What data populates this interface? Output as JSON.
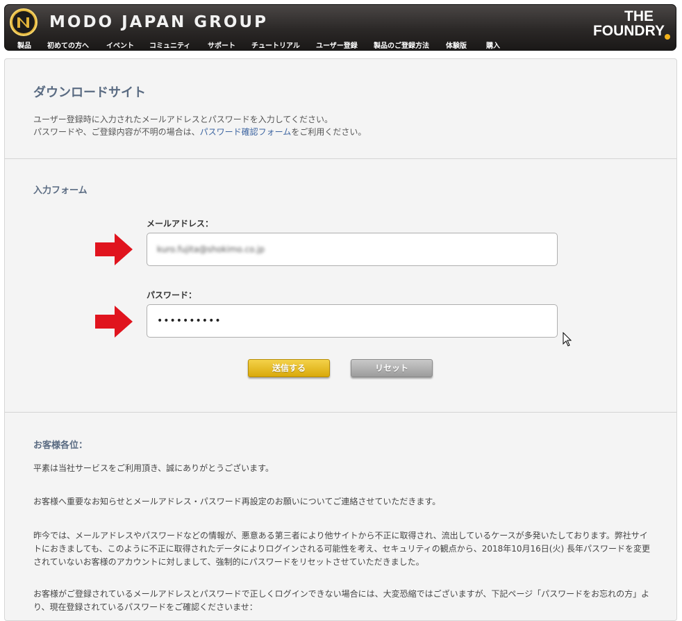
{
  "header": {
    "brand_title": "MODO JAPAN GROUP",
    "foundry_line1": "THE",
    "foundry_line2": "FOUNDRY",
    "nav": [
      "製品",
      "初めての方へ",
      "イベント",
      "コミュニティ",
      "サポート",
      "チュートリアル",
      "ユーザー登録",
      "製品のご登録方法",
      "体験版",
      "購入"
    ]
  },
  "main": {
    "title": "ダウンロードサイト",
    "intro_line1": "ユーザー登録時に入力されたメールアドレスとパスワードを入力してください。",
    "intro_line2_before": "パスワードや、ご登録内容が不明の場合は、",
    "intro_line2_link": "パスワード確認フォーム",
    "intro_line2_after": "をご利用ください。"
  },
  "form": {
    "title": "入力フォーム",
    "email_label": "メールアドレス：",
    "email_value": "kuro.fujita@shokimo.co.jp",
    "password_label": "パスワード：",
    "password_value": "••••••••••",
    "submit_label": "送信する",
    "reset_label": "リセット"
  },
  "notice": {
    "title": "お客様各位：",
    "paragraphs": [
      "平素は当社サービスをご利用頂き、誠にありがとうございます。",
      "お客様へ重要なお知らせとメールアドレス・パスワード再設定のお願いについてご連絡させていただきます。",
      "昨今では、メールアドレスやパスワードなどの情報が、悪意ある第三者により他サイトから不正に取得され、流出しているケースが多発いたしております。弊社サイトにおきましても、このように不正に取得されたデータによりログインされる可能性を考え、セキュリティの観点から、2018年10月16日(火) 長年パスワードを変更されていないお客様のアカウントに対しまして、強制的にパスワードをリセットさせていただきました。",
      "お客様がご登録されているメールアドレスとパスワードで正しくログインできない場合には、大変恐縮ではございますが、下記ページ「パスワードをお忘れの方」より、現在登録されているパスワードをご確認くださいませ："
    ]
  },
  "colors": {
    "accent": "#5a6b82",
    "link": "#3c64a0",
    "arrow": "#e0141e",
    "submit": "#e0b520"
  }
}
